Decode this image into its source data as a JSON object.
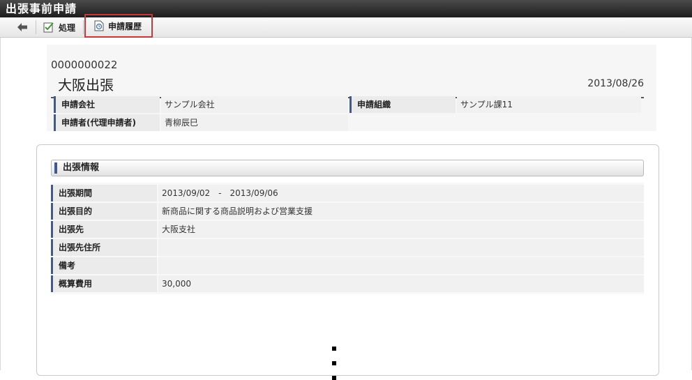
{
  "window": {
    "title": "出張事前申請"
  },
  "toolbar": {
    "back_icon": "arrow-left-icon",
    "process_label": "処理",
    "process_icon": "edit-check-icon",
    "history_label": "申請履歴",
    "history_icon": "history-document-icon",
    "highlight_color": "#c0393b"
  },
  "header": {
    "number": "0000000022",
    "title": "大阪出張",
    "date": "2013/08/26",
    "fields": [
      {
        "label": "申請会社",
        "value": "サンプル会社"
      },
      {
        "label": "申請組織",
        "value": "サンプル課11"
      },
      {
        "label": "申請者(代理申請者)",
        "value": "青柳辰巳"
      }
    ]
  },
  "section": {
    "title": "出張情報",
    "rows": [
      {
        "label": "出張期間",
        "value": "2013/09/02　-　2013/09/06"
      },
      {
        "label": "出張目的",
        "value": "新商品に関する商品説明および営業支援"
      },
      {
        "label": "出張先",
        "value": "大阪支社"
      },
      {
        "label": "出張先住所",
        "value": ""
      },
      {
        "label": "備考",
        "value": ""
      },
      {
        "label": "概算費用",
        "value": "30,000"
      }
    ]
  },
  "colors": {
    "accent_bar": "#3c5a98",
    "titlebar": "#2a2a2a"
  }
}
